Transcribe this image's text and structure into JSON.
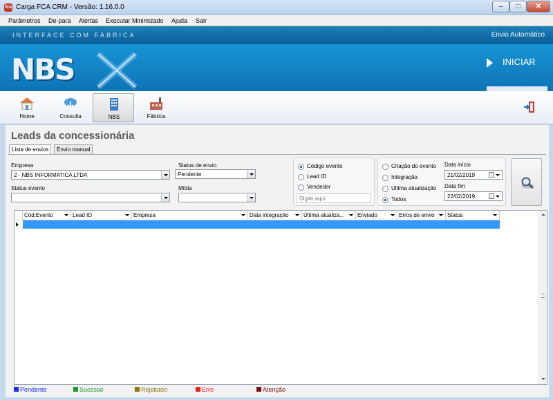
{
  "window": {
    "title": "Carga FCA CRM - Versão: 1.16.0.0",
    "app_icon_text": "fca"
  },
  "menu": [
    "Parâmetros",
    "De-para",
    "Alertas",
    "Executar Minimizado",
    "Ajuda",
    "Sair"
  ],
  "header": {
    "band_left": "INTERFACE COM FÁBRICA",
    "band_right": "Envio Automático",
    "logo": "NBS",
    "start_label": "INICIAR"
  },
  "toolbar": [
    {
      "label": "Home",
      "icon": "home-icon"
    },
    {
      "label": "Consulta",
      "icon": "cloud-download-icon"
    },
    {
      "label": "NBS",
      "icon": "building-icon"
    },
    {
      "label": "Fábrica",
      "icon": "factory-icon"
    }
  ],
  "section_title": "Leads da concessionária",
  "tabs": [
    "Lista de envios",
    "Envio manual"
  ],
  "filters": {
    "empresa_label": "Empresa",
    "empresa_value": "2 - NBS INFORMATICA LTDA",
    "status_envio_label": "Status de envio",
    "status_envio_value": "Pendente",
    "status_evento_label": "Status evento",
    "status_evento_value": "",
    "midia_label": "Mídia",
    "midia_value": ""
  },
  "search_type": {
    "options": [
      "Código evento",
      "Lead ID",
      "Vendedor"
    ],
    "selected": 0,
    "placeholder": "Digite aqui"
  },
  "date_type": {
    "options": [
      "Criação do evento",
      "Integração",
      "Ultima atualização",
      "Todos"
    ],
    "selected": 3,
    "start_label": "Data início",
    "start_value": "21/02/2019",
    "end_label": "Data fim",
    "end_value": "22/02/2019"
  },
  "grid": {
    "columns": [
      "Cód.Evento",
      "Lead ID",
      "Empresa",
      "Data integração",
      "Última atualiza...",
      "Enviado",
      "Erros de envio",
      "Status"
    ]
  },
  "legend": [
    {
      "label": "Pendente",
      "color": "#1a2ef0"
    },
    {
      "label": "Sucesso",
      "color": "#1d9a32"
    },
    {
      "label": "Rejeitado",
      "color": "#8a7a10"
    },
    {
      "label": "Erro",
      "color": "#ff1a1a"
    },
    {
      "label": "Atenção",
      "color": "#7a1010"
    }
  ]
}
